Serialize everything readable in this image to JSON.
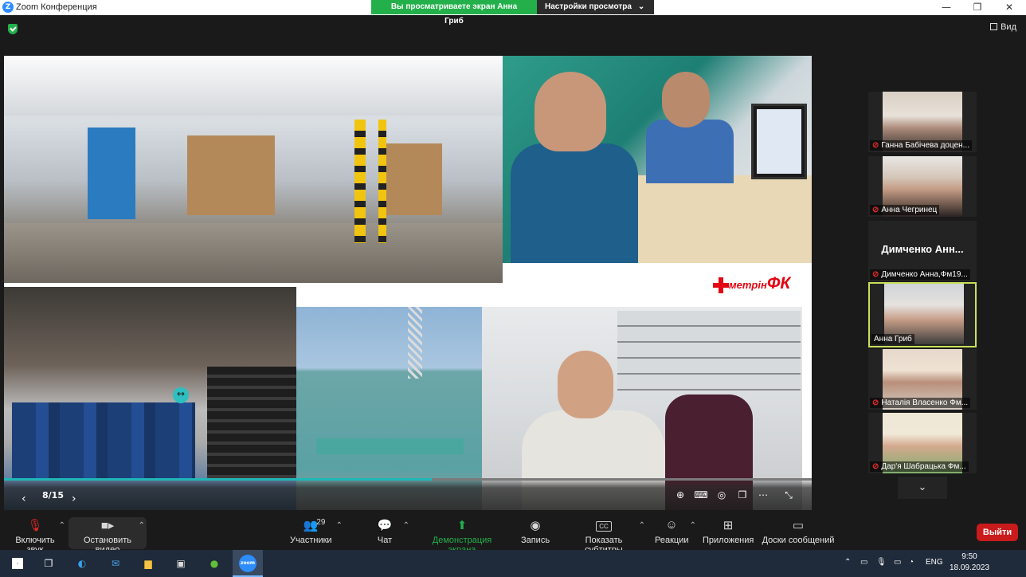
{
  "window": {
    "title": "Zoom Конференция",
    "minimize": "—",
    "restore": "❐",
    "close": "✕"
  },
  "share_banner": {
    "viewing_label": "Вы просматриваете экран Анна Гриб",
    "view_settings_label": "Настройки просмотра"
  },
  "top": {
    "view_label": "Вид"
  },
  "slide": {
    "page": "8/15",
    "progress": 0.53,
    "logo_text": "метрін",
    "logo_fk": "ФК"
  },
  "gallery": {
    "tiles": [
      {
        "name": "Ганна Бабічева доцен...",
        "muted": true
      },
      {
        "name": "Анна Чегринец",
        "muted": true
      },
      {
        "name": "Димченко Анна,Фм19...",
        "big_name": "Димченко Анн...",
        "muted": true
      },
      {
        "name": "Анна Гриб",
        "muted": false,
        "active": true
      },
      {
        "name": "Наталія Власенко Фм...",
        "muted": true
      },
      {
        "name": "Дар'я Шабрацька Фм...",
        "muted": true
      }
    ],
    "down": "⌄"
  },
  "toolbar": {
    "unmute": "Включить звук",
    "stop_video": "Остановить видео",
    "participants": "Участники",
    "participants_count": "29",
    "chat": "Чат",
    "share_screen": "Демонстрация экрана",
    "record": "Запись",
    "captions": "Показать субтитры",
    "captions_icon": "CC",
    "reactions": "Реакции",
    "apps": "Приложения",
    "whiteboards": "Доски сообщений",
    "leave": "Выйти"
  },
  "taskbar": {
    "lang": "ENG",
    "time": "9:50",
    "date": "18.09.2023",
    "zoom_icon_text": "zoom"
  },
  "colors": {
    "accent_green": "#23b04b",
    "zoom_blue": "#2d8cff",
    "leave_red": "#c91b1b",
    "active_border": "#c8e05a"
  }
}
